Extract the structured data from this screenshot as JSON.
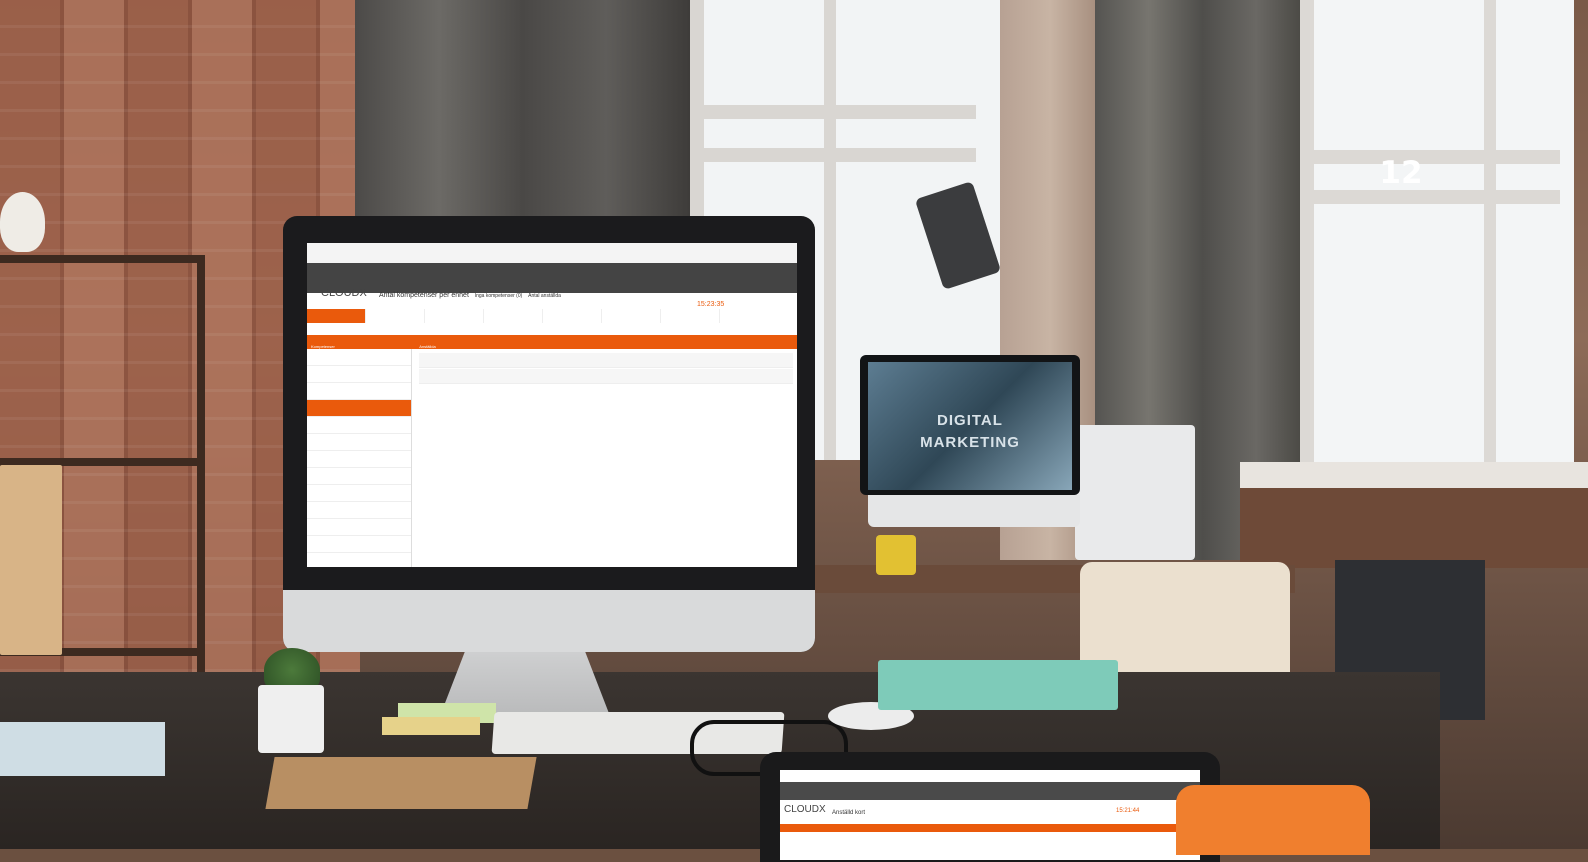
{
  "slide": {
    "page_number": "12"
  },
  "main_screen": {
    "logo": "CLOUDX",
    "title": "Antal kompetenser per enhet",
    "header_tab_1": "Inga kompetenser (0)",
    "header_tab_2": "Antal anställda",
    "clock": "15:23:35",
    "left_panel_header": "Kompetenser",
    "right_panel_header": "Anställda"
  },
  "second_screen": {
    "text_line_1": "DIGITAL",
    "text_line_2": "MARKETING"
  },
  "tablet": {
    "logo": "CLOUDX",
    "title": "Anställd kort",
    "clock": "15:21:44"
  },
  "colors": {
    "accent": "#ea5a0c",
    "card": "#f07f2e"
  }
}
